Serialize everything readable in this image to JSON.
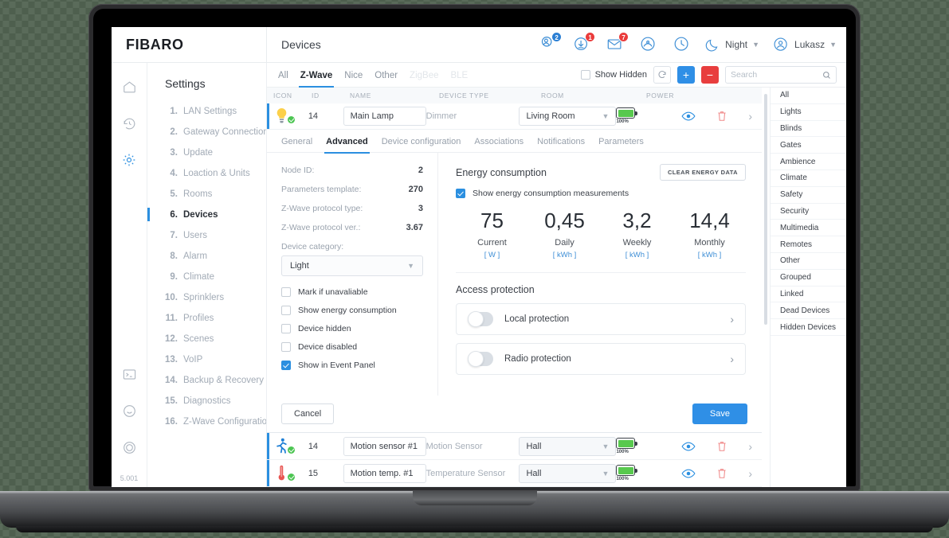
{
  "brand": {
    "name": "FIBARO",
    "version": "5.001"
  },
  "header": {
    "page_title": "Devices",
    "icons": [
      {
        "name": "users-icon",
        "badge": "2",
        "badge_color": "#2b7fd4"
      },
      {
        "name": "download-icon",
        "badge": "1",
        "badge_color": "#ea3b3b"
      },
      {
        "name": "mail-icon",
        "badge": "7",
        "badge_color": "#ea3b3b"
      },
      {
        "name": "weather-icon",
        "badge": ""
      },
      {
        "name": "clock-icon",
        "badge": ""
      }
    ],
    "night_label": "Night",
    "user_label": "Lukasz"
  },
  "nav": {
    "title": "Settings",
    "items": [
      {
        "num": "1.",
        "label": "LAN Settings"
      },
      {
        "num": "2.",
        "label": "Gateway Connections"
      },
      {
        "num": "3.",
        "label": "Update"
      },
      {
        "num": "4.",
        "label": "Loaction & Units"
      },
      {
        "num": "5.",
        "label": "Rooms"
      },
      {
        "num": "6.",
        "label": "Devices"
      },
      {
        "num": "7.",
        "label": "Users"
      },
      {
        "num": "8.",
        "label": "Alarm"
      },
      {
        "num": "9.",
        "label": "Climate"
      },
      {
        "num": "10.",
        "label": "Sprinklers"
      },
      {
        "num": "11.",
        "label": "Profiles"
      },
      {
        "num": "12.",
        "label": "Scenes"
      },
      {
        "num": "13.",
        "label": "VoIP"
      },
      {
        "num": "14.",
        "label": "Backup & Recovery"
      },
      {
        "num": "15.",
        "label": "Diagnostics"
      },
      {
        "num": "16.",
        "label": "Z-Wave Configuration"
      }
    ]
  },
  "toolbar": {
    "tabs": [
      {
        "label": "All",
        "state": "normal"
      },
      {
        "label": "Z-Wave",
        "state": "active"
      },
      {
        "label": "Nice",
        "state": "normal"
      },
      {
        "label": "Other",
        "state": "normal"
      },
      {
        "label": "ZigBee",
        "state": "disabled"
      },
      {
        "label": "BLE",
        "state": "disabled"
      }
    ],
    "show_hidden_label": "Show Hidden",
    "show_hidden_checked": false,
    "refresh_icon": "refresh-icon",
    "add_label": "+",
    "remove_label": "−",
    "search_placeholder": "Search",
    "search_value": ""
  },
  "table": {
    "columns": [
      "ICON",
      "ID",
      "NAME",
      "DEVICE TYPE",
      "ROOM",
      "POWER"
    ],
    "rows": [
      {
        "icon": "lightbulb-icon",
        "id": "14",
        "name": "Main Lamp",
        "type": "Dimmer",
        "room": "Living Room",
        "room_style": "white",
        "power_pct": "100%",
        "selected": true
      },
      {
        "icon": "motion-sensor-icon",
        "id": "14",
        "name": "Motion sensor #1",
        "type": "Motion Sensor",
        "room": "Hall",
        "room_style": "grey",
        "power_pct": "100%",
        "selected": false
      },
      {
        "icon": "thermometer-icon",
        "id": "15",
        "name": "Motion temp. #1",
        "type": "Temperature Sensor",
        "room": "Hall",
        "room_style": "grey",
        "power_pct": "100%",
        "selected": false
      }
    ]
  },
  "detail": {
    "tabs": [
      {
        "label": "General",
        "state": "normal"
      },
      {
        "label": "Advanced",
        "state": "active"
      },
      {
        "label": "Device configuration",
        "state": "normal"
      },
      {
        "label": "Associations",
        "state": "normal"
      },
      {
        "label": "Notifications",
        "state": "normal"
      },
      {
        "label": "Parameters",
        "state": "normal"
      }
    ],
    "info": [
      {
        "key": "Node ID:",
        "value": "2"
      },
      {
        "key": "Parameters template:",
        "value": "270"
      },
      {
        "key": "Z-Wave protocol type:",
        "value": "3"
      },
      {
        "key": "Z-Wave protocol ver.:",
        "value": "3.67"
      }
    ],
    "category_label": "Device category:",
    "category_value": "Light",
    "checkboxes": [
      {
        "label": "Mark if unavaliable",
        "checked": false
      },
      {
        "label": "Show energy consumption",
        "checked": false
      },
      {
        "label": "Device hidden",
        "checked": false
      },
      {
        "label": "Device disabled",
        "checked": false
      },
      {
        "label": "Show in Event Panel",
        "checked": true
      }
    ],
    "energy": {
      "title": "Energy consumption",
      "clear_button": "CLEAR ENERGY DATA",
      "show_measurements_label": "Show energy consumption measurements",
      "show_measurements_checked": true
    },
    "protection": {
      "title": "Access protection",
      "items": [
        {
          "label": "Local protection",
          "on": false
        },
        {
          "label": "Radio protection",
          "on": false
        }
      ]
    },
    "cancel_label": "Cancel",
    "save_label": "Save"
  },
  "categories": [
    "All",
    "Lights",
    "Blinds",
    "Gates",
    "Ambience",
    "Climate",
    "Safety",
    "Security",
    "Multimedia",
    "Remotes",
    "Other",
    "Grouped",
    "Linked",
    "Dead Devices",
    "Hidden Devices"
  ],
  "chart_data": {
    "type": "bar",
    "title": "Energy consumption",
    "categories": [
      "Current",
      "Daily",
      "Weekly",
      "Monthly"
    ],
    "values": [
      75,
      0.45,
      3.2,
      14.4
    ],
    "value_labels": [
      "75",
      "0,45",
      "3,2",
      "14,4"
    ],
    "units": [
      "[ W ]",
      "[ kWh ]",
      "[ kWh ]",
      "[ kWh ]"
    ],
    "xlabel": "",
    "ylabel": "",
    "legend": []
  },
  "colors": {
    "accent": "#2b8fe0",
    "danger": "#e83e3e",
    "ok": "#4cc552",
    "muted": "#9aa3ae"
  }
}
